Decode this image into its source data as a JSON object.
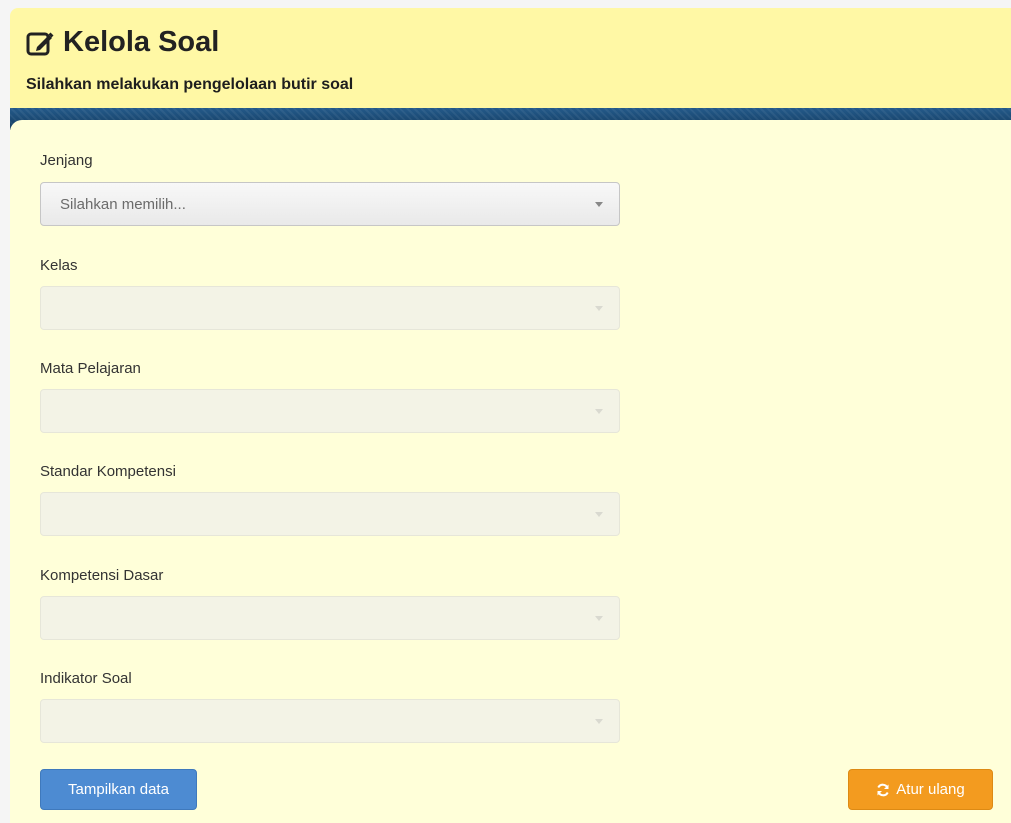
{
  "header": {
    "title": "Kelola Soal",
    "subtitle": "Silahkan melakukan pengelolaan butir soal",
    "title_icon": "edit-icon"
  },
  "form": {
    "fields": [
      {
        "label": "Jenjang",
        "value": "Silahkan memilih...",
        "enabled": true
      },
      {
        "label": "Kelas",
        "value": "",
        "enabled": false
      },
      {
        "label": "Mata Pelajaran",
        "value": "",
        "enabled": false
      },
      {
        "label": "Standar Kompetensi",
        "value": "",
        "enabled": false
      },
      {
        "label": "Kompetensi Dasar",
        "value": "",
        "enabled": false
      },
      {
        "label": "Indikator Soal",
        "value": "",
        "enabled": false
      }
    ]
  },
  "actions": {
    "show_label": "Tampilkan data",
    "reset_label": "Atur ulang",
    "reset_icon": "refresh-icon"
  },
  "colors": {
    "header_bg": "#fff8a5",
    "content_bg": "#ffffd9",
    "primary": "#4d8bd2",
    "warning": "#f39b1f"
  }
}
